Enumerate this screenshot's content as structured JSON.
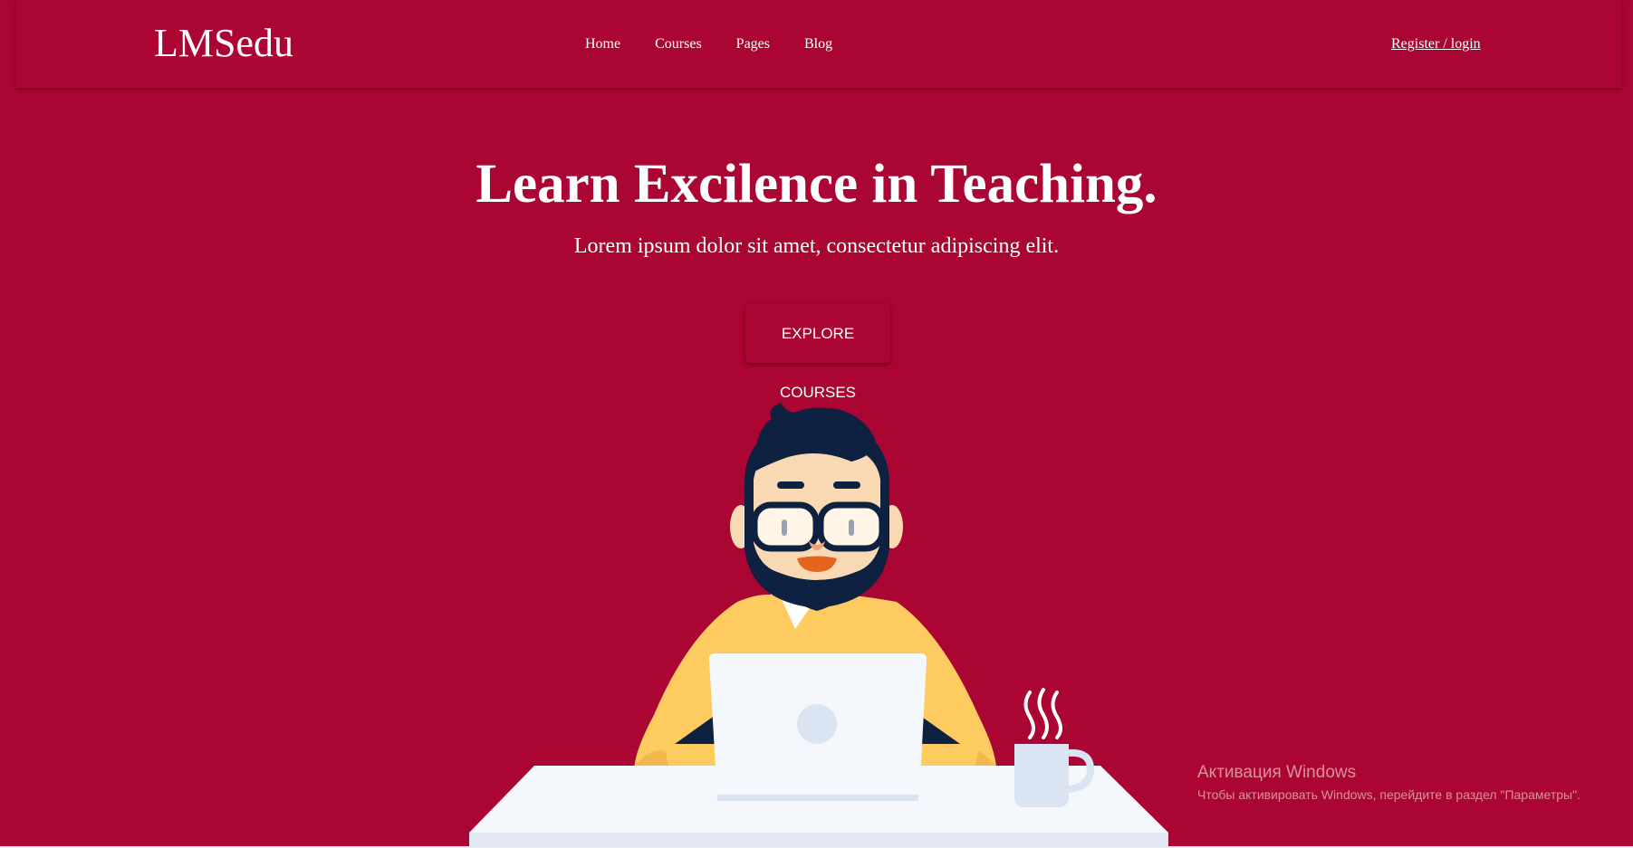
{
  "brand": {
    "logo": "LMSedu"
  },
  "nav": {
    "items": [
      "Home",
      "Courses",
      "Pages",
      "Blog"
    ]
  },
  "auth": {
    "label": "Register / login"
  },
  "hero": {
    "title": "Learn Excilence in Teaching.",
    "subtitle": "Lorem ipsum dolor sit amet, consectetur adipiscing elit.",
    "cta_label": "EXPLORE COURSES"
  },
  "watermark": {
    "title": "Активация Windows",
    "subtitle": "Чтобы активировать Windows, перейдите в раздел \"Параметры\"."
  },
  "colors": {
    "background": "#ab0534",
    "text": "#ffffff",
    "sweater": "#fdcb5f",
    "desk": "#f4f7fc",
    "hair": "#0f2140",
    "skin": "#f8d9b3"
  }
}
